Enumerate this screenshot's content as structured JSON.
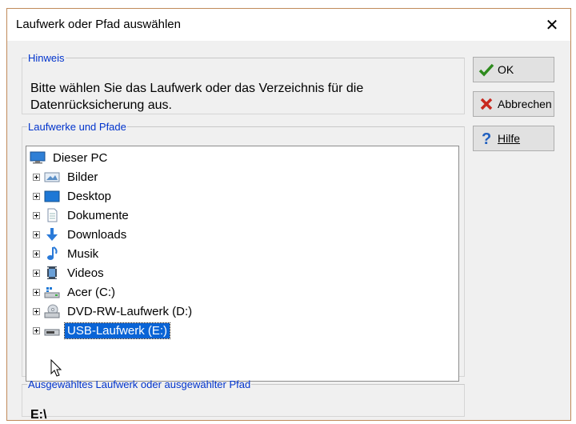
{
  "window": {
    "title": "Laufwerk oder Pfad auswählen",
    "close_glyph": "✕"
  },
  "hint": {
    "legend": "Hinweis",
    "text": "Bitte wählen Sie das Laufwerk oder das Verzeichnis für die Datenrücksicherung aus."
  },
  "drives": {
    "legend": "Laufwerke und Pfade",
    "root": {
      "label": "Dieser PC",
      "icon": "computer-icon"
    },
    "items": [
      {
        "label": "Bilder",
        "icon": "pictures-folder-icon"
      },
      {
        "label": "Desktop",
        "icon": "desktop-icon"
      },
      {
        "label": "Dokumente",
        "icon": "documents-icon"
      },
      {
        "label": "Downloads",
        "icon": "downloads-icon"
      },
      {
        "label": "Musik",
        "icon": "music-icon"
      },
      {
        "label": "Videos",
        "icon": "videos-icon"
      },
      {
        "label": "Acer (C:)",
        "icon": "hard-drive-icon"
      },
      {
        "label": "DVD-RW-Laufwerk (D:)",
        "icon": "dvd-drive-icon"
      },
      {
        "label": "USB-Laufwerk (E:)",
        "icon": "usb-drive-icon",
        "selected": true
      }
    ]
  },
  "selected_path": {
    "legend": "Ausgewähltes Laufwerk oder ausgewählter Pfad",
    "value": "E:\\"
  },
  "buttons": {
    "ok": "OK",
    "cancel": "Abbrechen",
    "help": "Hilfe"
  },
  "colors": {
    "legend": "#0033cc",
    "selection": "#0a64d6",
    "ok_check": "#2e8b1e",
    "cancel_x": "#c8281e",
    "help_q": "#1f5fbf"
  }
}
